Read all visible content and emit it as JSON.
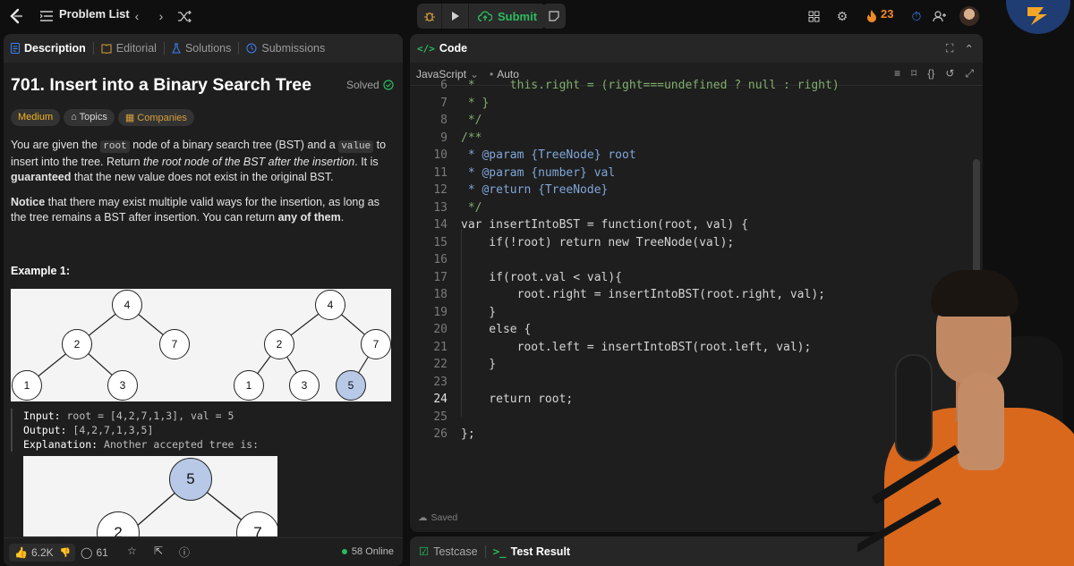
{
  "topbar": {
    "problem_list": "Problem List",
    "submit": "Submit",
    "streak": "23"
  },
  "left_tabs": [
    "Description",
    "Editorial",
    "Solutions",
    "Submissions"
  ],
  "problem": {
    "title": "701. Insert into a Binary Search Tree",
    "status": "Solved",
    "difficulty": "Medium",
    "topics": "Topics",
    "companies": "Companies",
    "p1_a": "You are given the ",
    "p1_code1": "root",
    "p1_b": " node of a binary search tree (BST) and a ",
    "p1_code2": "value",
    "p1_c": " to insert into the tree. Return ",
    "p1_em": "the root node of the BST after the insertion",
    "p1_d": ". It is ",
    "p1_strong": "guaranteed",
    "p1_e": " that the new value does not exist in the original BST.",
    "p2_strong1": "Notice",
    "p2_a": " that there may exist multiple valid ways for the insertion, as long as the tree remains a BST after insertion. You can return ",
    "p2_strong2": "any of them",
    "p2_b": ".",
    "example_title": "Example 1:",
    "input_label": "Input:",
    "input_value": " root = [4,2,7,1,3], val = 5",
    "output_label": "Output:",
    "output_value": " [4,2,7,1,3,5]",
    "explanation_label": "Explanation:",
    "explanation_value": " Another accepted tree is:"
  },
  "trees": {
    "left": [
      "4",
      "2",
      "7",
      "1",
      "3"
    ],
    "right": [
      "4",
      "2",
      "7",
      "1",
      "3",
      "5"
    ],
    "third": [
      "5",
      "2",
      "7"
    ]
  },
  "left_footer": {
    "likes": "6.2K",
    "comments": "61",
    "online": "58 Online"
  },
  "code_panel": {
    "title": "Code",
    "language": "JavaScript",
    "mode": "Auto",
    "saved": "Saved"
  },
  "code_lines": [
    {
      "n": "6",
      "t": " *     this.right = (right===undefined ? null : right)"
    },
    {
      "n": "7",
      "t": " * }"
    },
    {
      "n": "8",
      "t": " */"
    },
    {
      "n": "9",
      "t": "/**"
    },
    {
      "n": "10",
      "t": " * @param {TreeNode} root"
    },
    {
      "n": "11",
      "t": " * @param {number} val"
    },
    {
      "n": "12",
      "t": " * @return {TreeNode}"
    },
    {
      "n": "13",
      "t": " */"
    },
    {
      "n": "14",
      "t": "var insertIntoBST = function(root, val) {"
    },
    {
      "n": "15",
      "t": "    if(!root) return new TreeNode(val);"
    },
    {
      "n": "16",
      "t": ""
    },
    {
      "n": "17",
      "t": "    if(root.val < val){"
    },
    {
      "n": "18",
      "t": "        root.right = insertIntoBST(root.right, val);"
    },
    {
      "n": "19",
      "t": "    }"
    },
    {
      "n": "20",
      "t": "    else {"
    },
    {
      "n": "21",
      "t": "        root.left = insertIntoBST(root.left, val);"
    },
    {
      "n": "22",
      "t": "    }"
    },
    {
      "n": "23",
      "t": ""
    },
    {
      "n": "24",
      "t": "    return root;"
    },
    {
      "n": "25",
      "t": ""
    },
    {
      "n": "26",
      "t": "};"
    }
  ],
  "bottom_tabs": {
    "testcase": "Testcase",
    "test_result": "Test Result"
  }
}
